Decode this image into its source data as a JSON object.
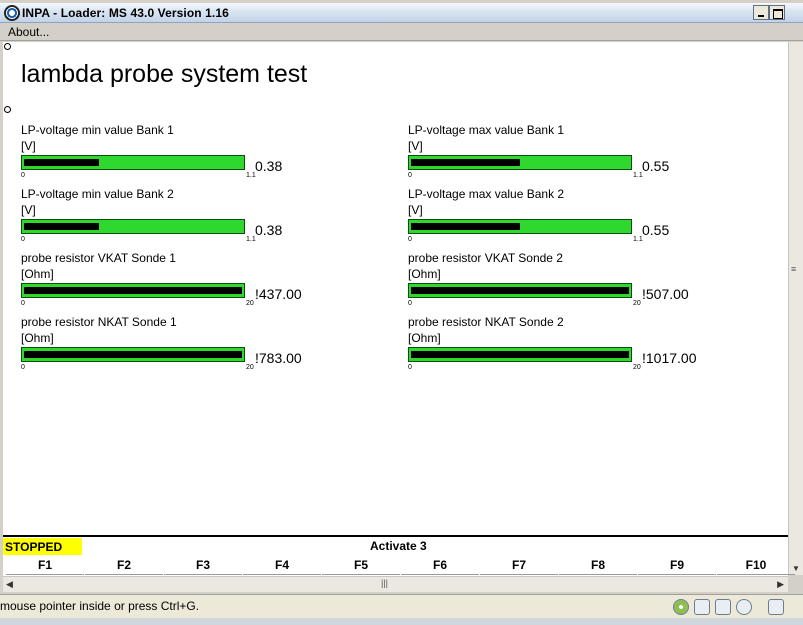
{
  "window": {
    "title": "INPA - Loader:  MS 43.0 Version 1.16"
  },
  "menu": {
    "about": "About..."
  },
  "page": {
    "title": "lambda probe system test"
  },
  "measurements": [
    {
      "label": "LP-voltage min value Bank 1",
      "unit": "[V]",
      "value": "0.38",
      "min": "0",
      "max": "1.1",
      "fill_fraction": 0.345
    },
    {
      "label": "LP-voltage max value Bank 1",
      "unit": "[V]",
      "value": "0.55",
      "min": "0",
      "max": "1.1",
      "fill_fraction": 0.5
    },
    {
      "label": "LP-voltage min value Bank 2",
      "unit": "[V]",
      "value": "0.38",
      "min": "0",
      "max": "1.1",
      "fill_fraction": 0.345
    },
    {
      "label": "LP-voltage max value Bank 2",
      "unit": "[V]",
      "value": "0.55",
      "min": "0",
      "max": "1.1",
      "fill_fraction": 0.5
    },
    {
      "label": "probe resistor VKAT Sonde 1",
      "unit": "[Ohm]",
      "value": "!437.00",
      "min": "0",
      "max": "20",
      "fill_fraction": 1.0
    },
    {
      "label": "probe resistor VKAT Sonde 2",
      "unit": "[Ohm]",
      "value": "!507.00",
      "min": "0",
      "max": "20",
      "fill_fraction": 1.0
    },
    {
      "label": "probe resistor NKAT Sonde 1",
      "unit": "[Ohm]",
      "value": "!783.00",
      "min": "0",
      "max": "20",
      "fill_fraction": 1.0
    },
    {
      "label": "probe resistor NKAT Sonde 2",
      "unit": "[Ohm]",
      "value": "!1017.00",
      "min": "0",
      "max": "20",
      "fill_fraction": 1.0
    }
  ],
  "status": {
    "state": "STOPPED",
    "activate": "Activate 3"
  },
  "function_keys": [
    "F1",
    "F2",
    "F3",
    "F4",
    "F5",
    "F6",
    "F7",
    "F8",
    "F9",
    "F10"
  ],
  "statusbar": {
    "text": "mouse pointer inside or press Ctrl+G."
  },
  "colors": {
    "bar_fill": "#2ed82e",
    "stopped_bg": "#ffff00"
  },
  "icons": [
    "app-icon",
    "minimize-icon",
    "maximize-icon",
    "disc-icon",
    "drive-icon",
    "book-icon",
    "network-icon"
  ]
}
